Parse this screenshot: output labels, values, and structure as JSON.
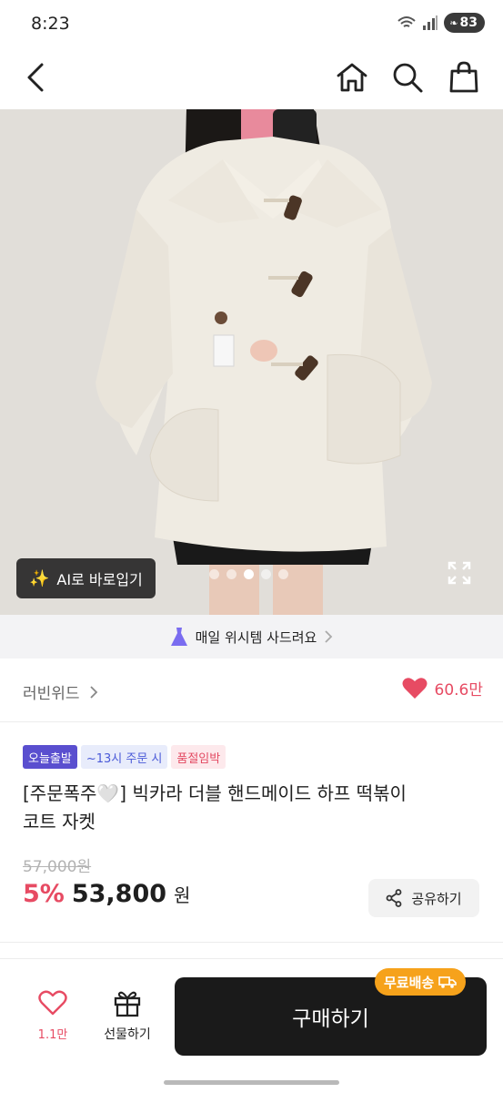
{
  "status": {
    "time": "8:23",
    "battery": "83"
  },
  "nav": {
    "back_icon": "chevron-left-icon",
    "home_icon": "home-icon",
    "search_icon": "search-icon",
    "cart_icon": "shopping-bag-icon"
  },
  "hero": {
    "ai_button_label": "AI로 바로입기",
    "dots_total": 5,
    "dots_active_index": 2,
    "expand_icon": "expand-icon"
  },
  "banner": {
    "text": "매일 위시템 사드려요"
  },
  "brand": {
    "name": "러빈위드",
    "like_count": "60.6만"
  },
  "product": {
    "badges": {
      "today": "오늘출발",
      "time": "~13시 주문 시",
      "soldout": "품절임박"
    },
    "title_line1": "[주문폭주🤍] 빅카라 더블 핸드메이드 하프 떡볶이",
    "title_line2": "코트 자켓",
    "original_price": "57,000원",
    "discount": "5%",
    "price": "53,800",
    "currency": "원",
    "share_label": "공유하기"
  },
  "bottom": {
    "wish_count": "1.1만",
    "gift_label": "선물하기",
    "buy_label": "구매하기",
    "free_shipping": "무료배송"
  },
  "colors": {
    "accent": "#e74b63",
    "purple": "#5a4fcf",
    "orange": "#f6a21b",
    "dark": "#1a1a1a"
  }
}
